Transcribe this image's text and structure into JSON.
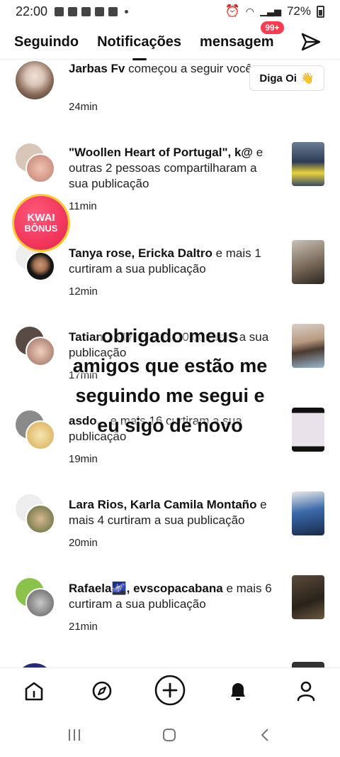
{
  "status_bar": {
    "time": "22:00",
    "battery": "72%"
  },
  "tabs": {
    "following": "Seguindo",
    "notifications": "Notificações",
    "messages": "mensagem",
    "messages_badge": "99+"
  },
  "overlay_caption": [
    "obrigado meus",
    "amigos que estão me",
    "seguindo me segui e",
    "eu sigo de novo"
  ],
  "kwai": {
    "line1": "KWAI",
    "line2": "BÔNUS"
  },
  "notifications": [
    {
      "name": "Jarbas Fv",
      "text": " começou a seguir você",
      "time": "24min",
      "action": "Diga Oi",
      "action_emoji": "👋"
    },
    {
      "name": "\"Woollen Heart of Portugal\", k@",
      "text": " e outras 2 pessoas compartilharam a sua publicação",
      "time": "11min"
    },
    {
      "name": "Tanya rose, Ericka Daltro",
      "text": " e mais 1 curtiram a sua publicação",
      "time": "12min"
    },
    {
      "name": "Tatian...447",
      "text": " e mais 20 curtiram a sua publicação",
      "time": "17min"
    },
    {
      "name": "asdo...",
      "text": " e mais 16 curtiram a sua publicação",
      "time": "19min"
    },
    {
      "name": "Lara Rios, Karla Camila Montaño",
      "text": " e mais 4 curtiram a sua publicação",
      "time": "20min"
    },
    {
      "name": "Rafaela🌌, evscopacabana",
      "text": " e mais 6 curtiram a sua publicação",
      "time": "21min"
    }
  ],
  "icons": {
    "send": "send-icon",
    "home": "home-icon",
    "discover": "compass-icon",
    "create": "plus-circle-icon",
    "notifications": "bell-icon",
    "profile": "person-icon"
  },
  "colors": {
    "badge": "#ff3b4f",
    "kwai": "#e8204a"
  }
}
